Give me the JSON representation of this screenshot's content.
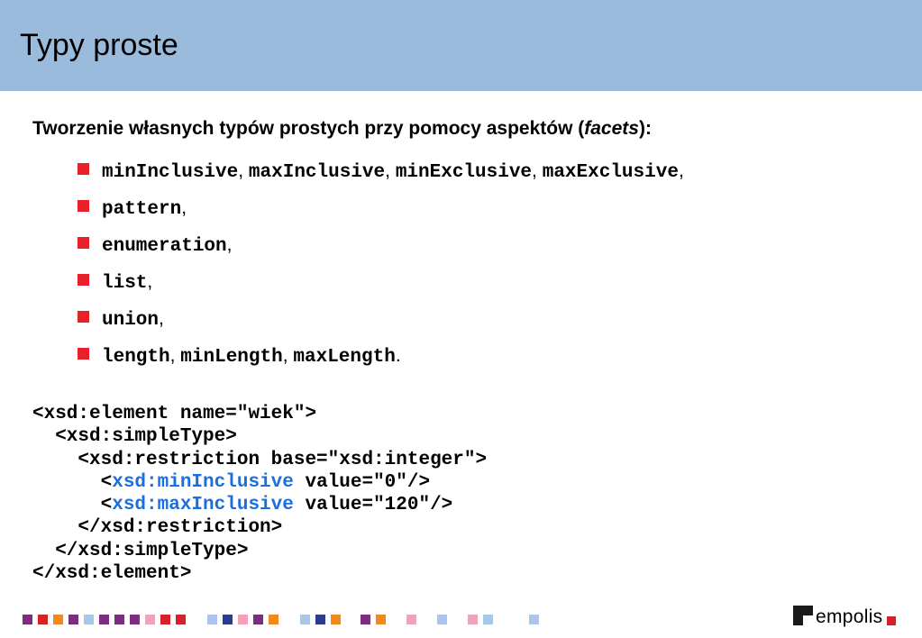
{
  "title": "Typy proste",
  "intro": {
    "text": "Tworzenie własnych typów prostych przy pomocy aspektów (",
    "italic": "facets",
    "suffix": "):"
  },
  "bullets": [
    [
      {
        "t": "minInclusive",
        "mono": true
      },
      {
        "t": ", "
      },
      {
        "t": "maxInclusive",
        "mono": true
      },
      {
        "t": ", "
      },
      {
        "t": "minExclusive",
        "mono": true
      },
      {
        "t": ", "
      },
      {
        "t": "maxExclusive",
        "mono": true
      },
      {
        "t": ","
      }
    ],
    [
      {
        "t": "pattern",
        "mono": true
      },
      {
        "t": ","
      }
    ],
    [
      {
        "t": "enumeration",
        "mono": true
      },
      {
        "t": ","
      }
    ],
    [
      {
        "t": "list",
        "mono": true
      },
      {
        "t": ","
      }
    ],
    [
      {
        "t": "union",
        "mono": true
      },
      {
        "t": ","
      }
    ],
    [
      {
        "t": "length",
        "mono": true
      },
      {
        "t": ", "
      },
      {
        "t": "minLength",
        "mono": true
      },
      {
        "t": ", "
      },
      {
        "t": "maxLength",
        "mono": true
      },
      {
        "t": "."
      }
    ]
  ],
  "code_lines": [
    [
      {
        "t": "<xsd:element name=\"wiek\">"
      }
    ],
    [
      {
        "t": "  <xsd:simpleType>"
      }
    ],
    [
      {
        "t": "    <xsd:restriction base=\"xsd:integer\">"
      }
    ],
    [
      {
        "t": "      <"
      },
      {
        "t": "xsd:minInclusive",
        "kw": true
      },
      {
        "t": " value=\"0\"/>"
      }
    ],
    [
      {
        "t": "      <"
      },
      {
        "t": "xsd:maxInclusive",
        "kw": true
      },
      {
        "t": " value=\"120\"/>"
      }
    ],
    [
      {
        "t": "    </xsd:restriction>"
      }
    ],
    [
      {
        "t": "  </xsd:simpleType>"
      }
    ],
    [
      {
        "t": "</xsd:element>"
      }
    ]
  ],
  "colors": {
    "header_bg": "#9bbbdc",
    "bullet": "#e8202a",
    "code_keyword": "#1a6fe0"
  },
  "footer_strip": [
    "#7b2d7e",
    "#d6202a",
    "#f08a1c",
    "#7b2d7e",
    "#a8c8e8",
    "#7b2d7e",
    "#7b2d7e",
    "#7b2d7e",
    "#f5a0b8",
    "#d6202a",
    "#d6202a",
    "#a8c8e8",
    "#2c3c8c",
    "#f5a0b8",
    "#7b2d7e",
    "#f08a1c",
    "#a8c8e8",
    "#2c3c8c",
    "#f08a1c",
    "#7b2d7e",
    "#f08a1c",
    "#f5a0b8",
    "#a8c8e8",
    "#f5a0b8",
    "#a8c8e8",
    "#a8c8e8"
  ],
  "logo": {
    "text": "empolis"
  }
}
